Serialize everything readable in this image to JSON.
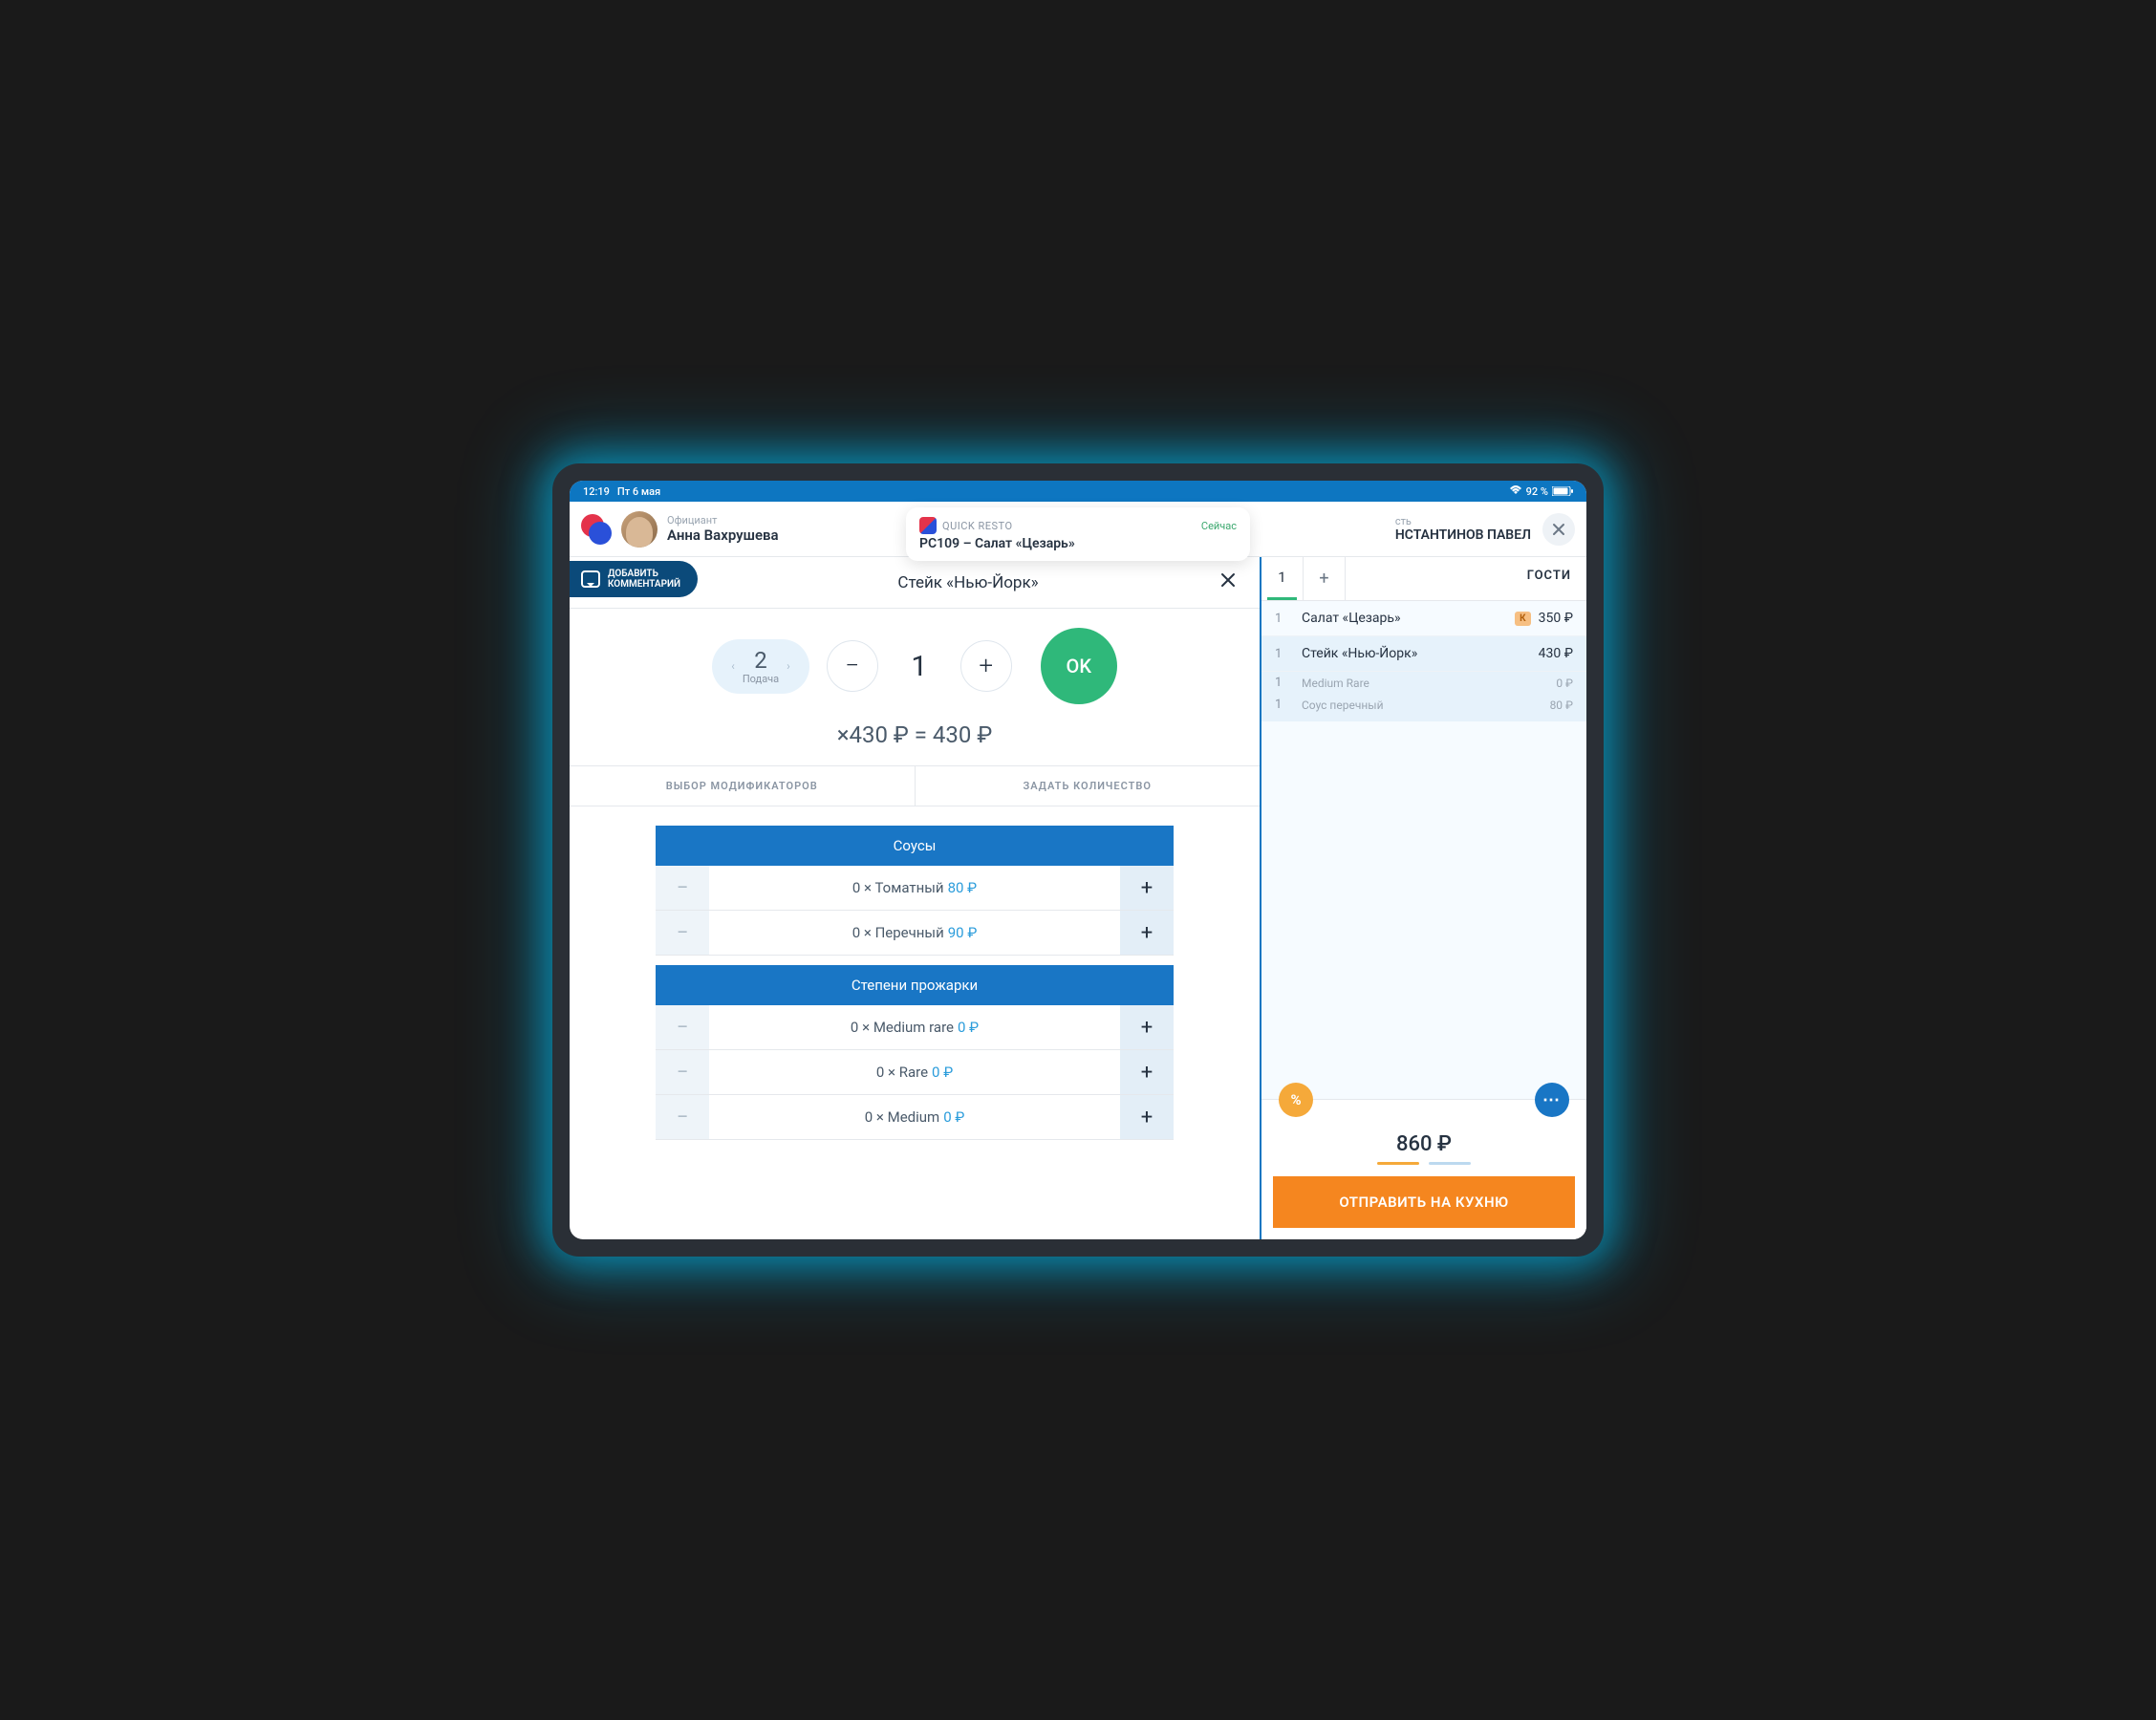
{
  "status": {
    "time": "12:19",
    "date": "Пт 6 мая",
    "battery": "92 %"
  },
  "header": {
    "waiter_label": "Официант",
    "waiter_name": "Анна Вахрушева",
    "guest_label": "сть",
    "guest_name": "НСТАНТИНОВ ПАВЕЛ"
  },
  "notification": {
    "app": "QUICK RESTO",
    "time": "Сейчас",
    "body": "PC109 – Салат «Цезарь»"
  },
  "comment_btn": {
    "line1": "ДОБАВИТЬ",
    "line2": "КОММЕНТАРИЙ"
  },
  "item": {
    "title": "Стейк «Нью-Йорк»",
    "serve_num": "2",
    "serve_label": "Подача",
    "qty": "1",
    "ok": "OK",
    "price_line": "×430 ₽ = 430 ₽"
  },
  "tabs": {
    "mods": "ВЫБОР МОДИФИКАТОРОВ",
    "qty": "ЗАДАТЬ КОЛИЧЕСТВО"
  },
  "mod_groups": [
    {
      "title": "Соусы",
      "rows": [
        {
          "qty": "0",
          "name": "Томатный",
          "price": "80 ₽"
        },
        {
          "qty": "0",
          "name": "Перечный",
          "price": "90 ₽"
        }
      ]
    },
    {
      "title": "Степени прожарки",
      "rows": [
        {
          "qty": "0",
          "name": "Medium rare",
          "price": "0 ₽"
        },
        {
          "qty": "0",
          "name": "Rare",
          "price": "0 ₽"
        },
        {
          "qty": "0",
          "name": "Medium",
          "price": "0 ₽"
        }
      ]
    }
  ],
  "side": {
    "guest_tab": "1",
    "guests_label": "ГОСТИ",
    "lines": [
      {
        "type": "item",
        "qty": "1",
        "name": "Салат «Цезарь»",
        "badge": "К",
        "price": "350 ₽",
        "selected": false
      },
      {
        "type": "item",
        "qty": "1",
        "name": "Стейк «Нью-Йорк»",
        "badge": "",
        "price": "430 ₽",
        "selected": true
      },
      {
        "type": "sub",
        "qty": "1",
        "name": "Medium Rare",
        "price": "0 ₽"
      },
      {
        "type": "sub",
        "qty": "1",
        "name": "Соус перечный",
        "price": "80 ₽"
      }
    ],
    "total": "860 ₽",
    "submit": "ОТПРАВИТЬ НА КУХНЮ"
  }
}
